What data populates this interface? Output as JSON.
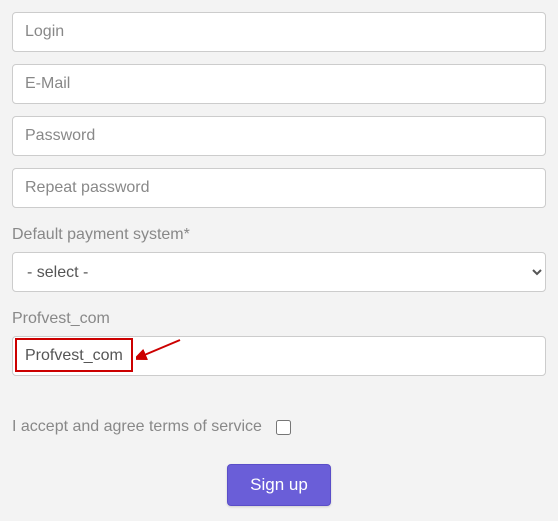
{
  "fields": {
    "login": {
      "placeholder": "Login",
      "value": ""
    },
    "email": {
      "placeholder": "E-Mail",
      "value": ""
    },
    "password": {
      "placeholder": "Password",
      "value": ""
    },
    "repeat_password": {
      "placeholder": "Repeat password",
      "value": ""
    }
  },
  "payment": {
    "label": "Default payment system*",
    "selected": "- select -"
  },
  "referral": {
    "label": "Profvest_com",
    "value": "Profvest_com"
  },
  "terms": {
    "label": "I accept and agree terms of service",
    "checked": false
  },
  "submit": {
    "label": "Sign up"
  }
}
